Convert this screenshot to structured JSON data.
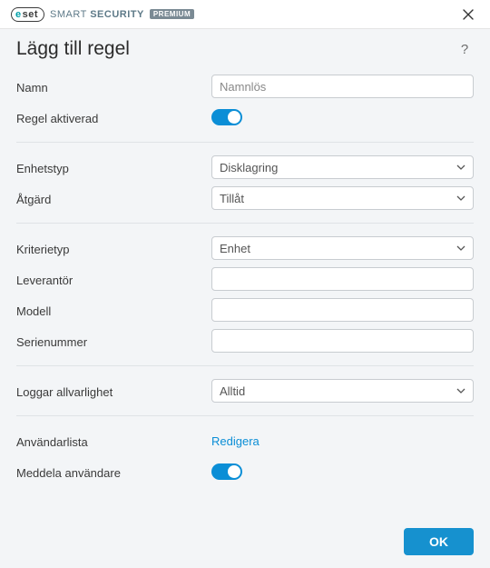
{
  "brand": {
    "eset": "eset",
    "product_thin": "SMART",
    "product_bold": "SECURITY",
    "badge": "PREMIUM"
  },
  "heading": "Lägg till regel",
  "help_symbol": "?",
  "labels": {
    "name": "Namn",
    "rule_enabled": "Regel aktiverad",
    "device_type": "Enhetstyp",
    "action": "Åtgärd",
    "criteria_type": "Kriterietyp",
    "vendor": "Leverantör",
    "model": "Modell",
    "serial": "Serienummer",
    "log_severity": "Loggar allvarlighet",
    "user_list": "Användarlista",
    "notify_user": "Meddela användare"
  },
  "fields": {
    "name_placeholder": "Namnlös",
    "device_type_value": "Disklagring",
    "action_value": "Tillåt",
    "criteria_type_value": "Enhet",
    "vendor_value": "",
    "model_value": "",
    "serial_value": "",
    "log_severity_value": "Alltid",
    "user_list_link": "Redigera"
  },
  "buttons": {
    "ok": "OK"
  }
}
